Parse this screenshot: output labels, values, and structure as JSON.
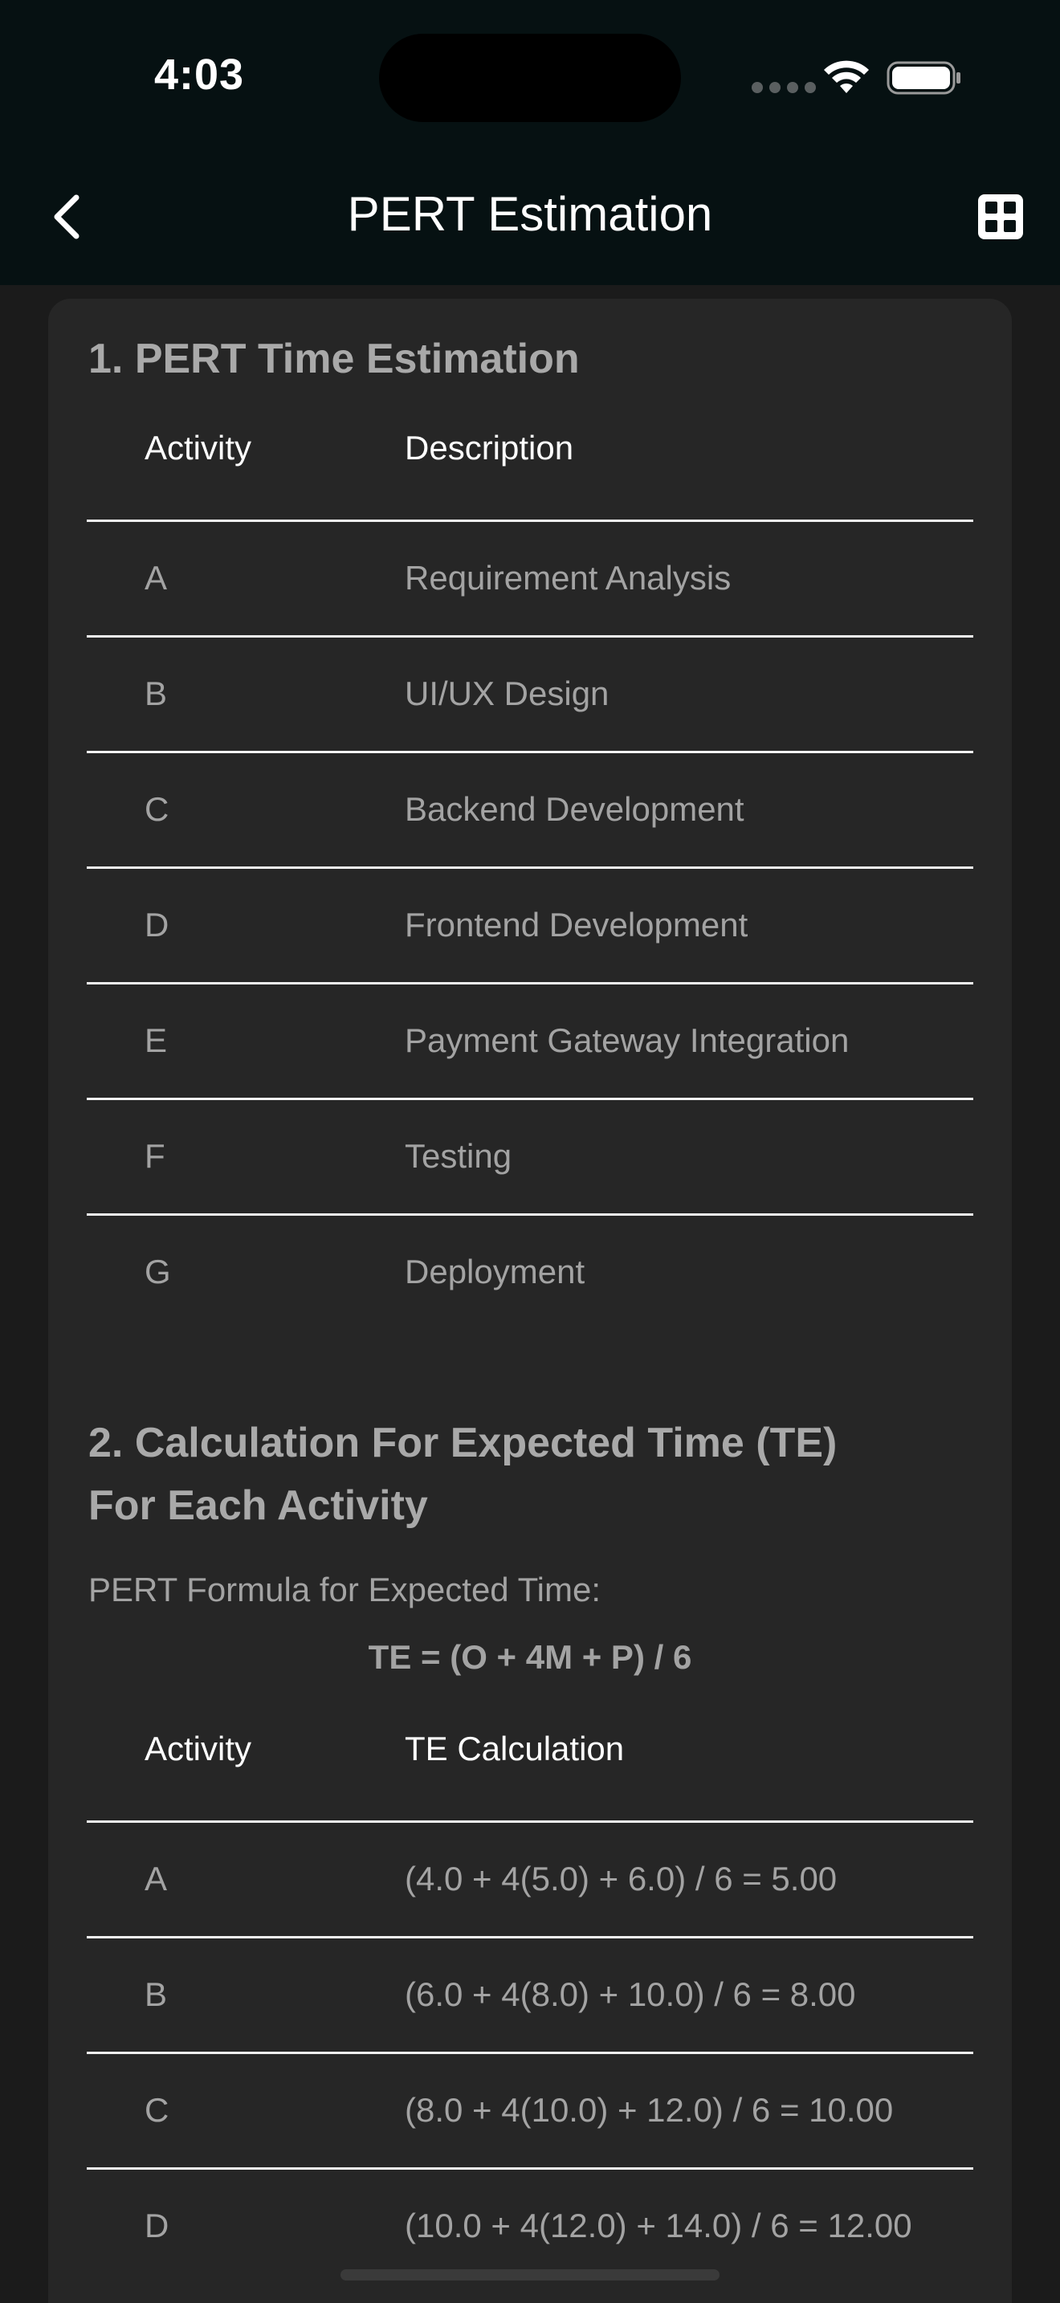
{
  "status_bar": {
    "time": "4:03"
  },
  "nav": {
    "title": "PERT Estimation",
    "back_icon": "chevron-left-icon",
    "right_icon": "grid-icon"
  },
  "section1": {
    "title": "1. PERT Time Estimation",
    "headers": [
      "Activity",
      "Description"
    ],
    "rows": [
      {
        "activity": "A",
        "description": "Requirement Analysis"
      },
      {
        "activity": "B",
        "description": "UI/UX Design"
      },
      {
        "activity": "C",
        "description": "Backend Development"
      },
      {
        "activity": "D",
        "description": "Frontend Development"
      },
      {
        "activity": "E",
        "description": "Payment Gateway Integration"
      },
      {
        "activity": "F",
        "description": "Testing"
      },
      {
        "activity": "G",
        "description": "Deployment"
      }
    ]
  },
  "section2": {
    "title_line1": "2. Calculation For Expected Time (TE)",
    "title_line2": "For Each Activity",
    "formula_label": "PERT Formula for Expected Time:",
    "formula": "TE = (O + 4M + P) / 6",
    "headers": [
      "Activity",
      "TE Calculation"
    ],
    "rows": [
      {
        "activity": "A",
        "calculation": "(4.0 + 4(5.0) + 6.0) / 6 = 5.00"
      },
      {
        "activity": "B",
        "calculation": "(6.0 + 4(8.0) + 10.0) / 6 = 8.00"
      },
      {
        "activity": "C",
        "calculation": "(8.0 + 4(10.0) + 12.0) / 6 = 10.00"
      },
      {
        "activity": "D",
        "calculation": "(10.0 + 4(12.0) + 14.0) / 6 = 12.00"
      }
    ]
  },
  "colors": {
    "background": "#1b1b1b",
    "card": "#262626",
    "topbar": "#061112",
    "divider": "#f2f2f2",
    "muted_text": "#a3a3a3"
  }
}
